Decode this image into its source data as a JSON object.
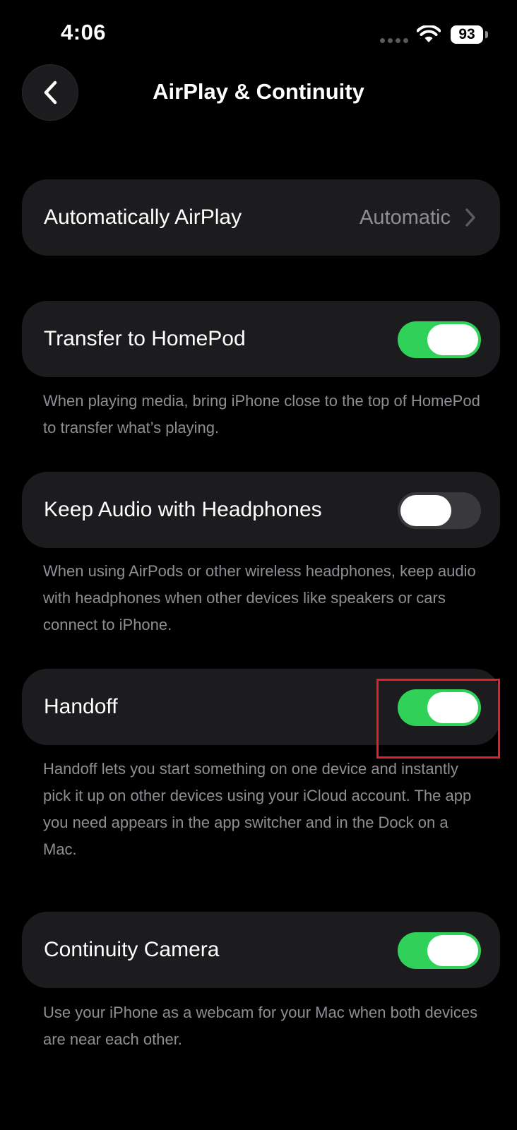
{
  "status_bar": {
    "time": "4:06",
    "battery": "93"
  },
  "nav": {
    "title": "AirPlay & Continuity"
  },
  "rows": {
    "airplay": {
      "label": "Automatically AirPlay",
      "value": "Automatic"
    },
    "homepod": {
      "label": "Transfer to HomePod",
      "on": true,
      "footnote": "When playing media, bring iPhone close to the top of HomePod to transfer what’s playing."
    },
    "headphones": {
      "label": "Keep Audio with Headphones",
      "on": false,
      "footnote": "When using AirPods or other wireless headphones, keep audio with headphones when other devices like speakers or cars connect to iPhone."
    },
    "handoff": {
      "label": "Handoff",
      "on": true,
      "footnote": "Handoff lets you start something on one device and instantly pick it up on other devices using your iCloud account. The app you need appears in the app switcher and in the Dock on a Mac."
    },
    "camera": {
      "label": "Continuity Camera",
      "on": true,
      "footnote": "Use your iPhone as a webcam for your Mac when both devices are near each other."
    }
  },
  "colors": {
    "toggle_on": "#30d158",
    "toggle_off": "#39393d",
    "cell_background": "#1c1c1e",
    "highlight": "#e0202a"
  }
}
